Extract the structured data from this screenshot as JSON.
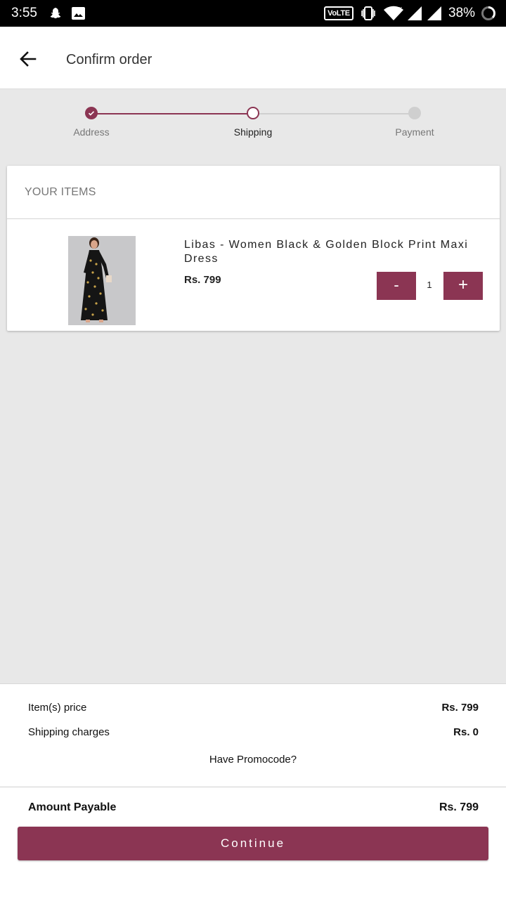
{
  "status_bar": {
    "time": "3:55",
    "network_badge": "VoLTE",
    "battery_percent": "38%"
  },
  "app_bar": {
    "title": "Confirm order",
    "back_icon": "arrow-left-icon"
  },
  "stepper": {
    "steps": [
      {
        "label": "Address",
        "state": "done"
      },
      {
        "label": "Shipping",
        "state": "current"
      },
      {
        "label": "Payment",
        "state": "todo"
      }
    ],
    "accent_color": "#8b3553"
  },
  "items_card": {
    "title": "YOUR ITEMS",
    "items": [
      {
        "name": "Libas - Women Black & Golden Block Print Maxi Dress",
        "price": "Rs. 799",
        "quantity": "1",
        "minus_label": "-",
        "plus_label": "+"
      }
    ]
  },
  "summary": {
    "items_price_label": "Item(s) price",
    "items_price_value": "Rs. 799",
    "shipping_label": "Shipping charges",
    "shipping_value": "Rs. 0",
    "promo_label": "Have Promocode?",
    "payable_label": "Amount Payable",
    "payable_value": "Rs. 799",
    "continue_label": "Continue"
  },
  "colors": {
    "brand": "#8b3553",
    "page_background": "#e8e8e8"
  }
}
